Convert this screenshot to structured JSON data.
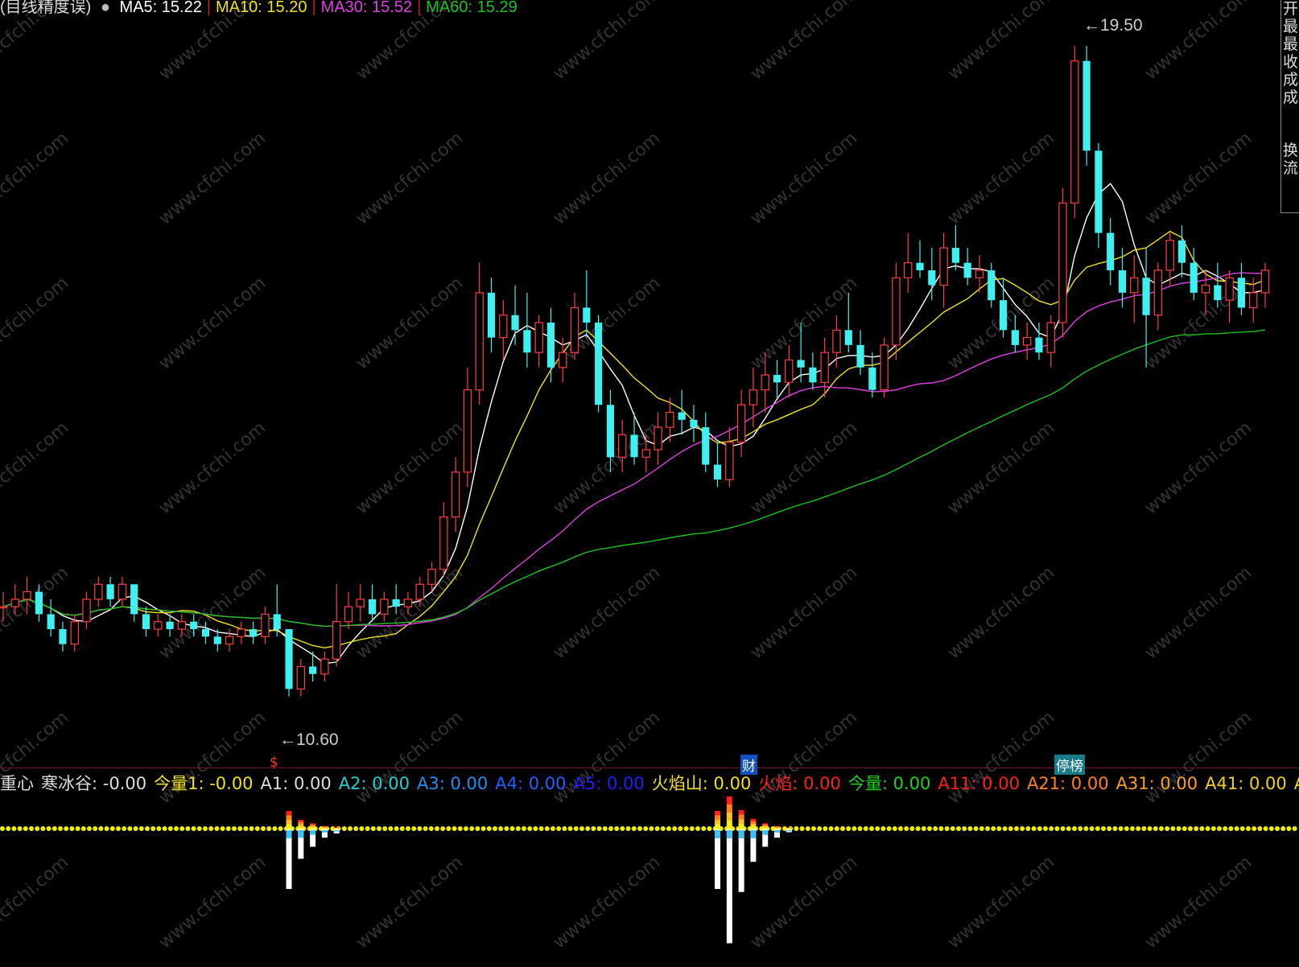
{
  "header": {
    "title_fragment": "(目线精度误)",
    "ma_items": [
      {
        "label": "MA5: 15.22",
        "color": "#ffffff"
      },
      {
        "label": "MA10: 15.20",
        "color": "#f0e020"
      },
      {
        "label": "MA30: 15.52",
        "color": "#e040e0"
      },
      {
        "label": "MA60: 15.29",
        "color": "#20c020"
      }
    ]
  },
  "price_labels": {
    "high": "19.50",
    "low": "10.60"
  },
  "events": [
    {
      "label": "$",
      "color": "#ff3030",
      "bg": "transparent"
    },
    {
      "label": "财",
      "color": "#ffffff",
      "bg": "#1050c0"
    },
    {
      "label": "停榜",
      "color": "#ffffff",
      "bg": "#1a7a8a"
    }
  ],
  "side_panel": [
    "开",
    "最",
    "最",
    "收",
    "成",
    "成",
    "",
    "",
    "换",
    "流"
  ],
  "indicator": {
    "items": [
      {
        "label": "重心",
        "color": "#dddddd"
      },
      {
        "label": "寒冰谷: -0.00",
        "color": "#dddddd"
      },
      {
        "label": "今量1: -0.00",
        "color": "#f0e020"
      },
      {
        "label": "A1: 0.00",
        "color": "#dddddd"
      },
      {
        "label": "A2: 0.00",
        "color": "#20d0d0"
      },
      {
        "label": "A3: 0.00",
        "color": "#2090f0"
      },
      {
        "label": "A4: 0.00",
        "color": "#2060ff"
      },
      {
        "label": "A5: 0.00",
        "color": "#2020ff"
      },
      {
        "label": "火焰山: 0.00",
        "color": "#f0e020"
      },
      {
        "label": "火焰: 0.00",
        "color": "#ff2020"
      },
      {
        "label": "今量: 0.00",
        "color": "#20d020"
      },
      {
        "label": "A11: 0.00",
        "color": "#ff2020"
      },
      {
        "label": "A21: 0.00",
        "color": "#ff8020"
      },
      {
        "label": "A31: 0.00",
        "color": "#ffa020"
      },
      {
        "label": "A41: 0.00",
        "color": "#f0d020"
      },
      {
        "label": "A",
        "color": "#f0d020"
      }
    ]
  },
  "colors": {
    "up": "#ff4040",
    "down": "#40f0f0",
    "ma5": "#ffffff",
    "ma10": "#f0e020",
    "ma30": "#e040e0",
    "ma60": "#20c020",
    "zero_line": "#f0f000",
    "watermark": "#333333"
  },
  "watermark": "www.cfchi.com",
  "chart_data": {
    "type": "candlestick",
    "ylim": [
      10.0,
      19.9
    ],
    "candles": [
      {
        "o": 12.0,
        "h": 12.2,
        "l": 11.8,
        "c": 12.0
      },
      {
        "o": 12.0,
        "h": 12.3,
        "l": 11.9,
        "c": 12.1
      },
      {
        "o": 12.1,
        "h": 12.4,
        "l": 11.9,
        "c": 12.2
      },
      {
        "o": 12.2,
        "h": 12.3,
        "l": 11.8,
        "c": 11.9
      },
      {
        "o": 11.9,
        "h": 12.1,
        "l": 11.6,
        "c": 11.7
      },
      {
        "o": 11.7,
        "h": 11.8,
        "l": 11.4,
        "c": 11.5
      },
      {
        "o": 11.5,
        "h": 11.9,
        "l": 11.4,
        "c": 11.8
      },
      {
        "o": 11.8,
        "h": 12.2,
        "l": 11.7,
        "c": 12.1
      },
      {
        "o": 12.1,
        "h": 12.4,
        "l": 12.0,
        "c": 12.3
      },
      {
        "o": 12.3,
        "h": 12.4,
        "l": 12.0,
        "c": 12.1
      },
      {
        "o": 12.1,
        "h": 12.4,
        "l": 12.0,
        "c": 12.3
      },
      {
        "o": 12.3,
        "h": 12.3,
        "l": 11.8,
        "c": 11.9
      },
      {
        "o": 11.9,
        "h": 12.0,
        "l": 11.6,
        "c": 11.7
      },
      {
        "o": 11.7,
        "h": 11.9,
        "l": 11.6,
        "c": 11.8
      },
      {
        "o": 11.8,
        "h": 11.9,
        "l": 11.6,
        "c": 11.7
      },
      {
        "o": 11.7,
        "h": 11.9,
        "l": 11.6,
        "c": 11.8
      },
      {
        "o": 11.8,
        "h": 11.9,
        "l": 11.6,
        "c": 11.7
      },
      {
        "o": 11.7,
        "h": 11.8,
        "l": 11.5,
        "c": 11.6
      },
      {
        "o": 11.6,
        "h": 11.7,
        "l": 11.4,
        "c": 11.5
      },
      {
        "o": 11.5,
        "h": 11.7,
        "l": 11.4,
        "c": 11.6
      },
      {
        "o": 11.6,
        "h": 11.8,
        "l": 11.5,
        "c": 11.7
      },
      {
        "o": 11.7,
        "h": 11.8,
        "l": 11.5,
        "c": 11.6
      },
      {
        "o": 11.6,
        "h": 12.0,
        "l": 11.5,
        "c": 11.9
      },
      {
        "o": 11.9,
        "h": 12.3,
        "l": 11.6,
        "c": 11.7
      },
      {
        "o": 11.7,
        "h": 11.7,
        "l": 10.8,
        "c": 10.9
      },
      {
        "o": 10.9,
        "h": 11.3,
        "l": 10.8,
        "c": 11.2
      },
      {
        "o": 11.2,
        "h": 11.4,
        "l": 11.0,
        "c": 11.1
      },
      {
        "o": 11.1,
        "h": 11.4,
        "l": 11.0,
        "c": 11.3
      },
      {
        "o": 11.3,
        "h": 12.3,
        "l": 11.2,
        "c": 11.8
      },
      {
        "o": 11.8,
        "h": 12.2,
        "l": 11.7,
        "c": 12.0
      },
      {
        "o": 12.0,
        "h": 12.3,
        "l": 11.8,
        "c": 12.1
      },
      {
        "o": 12.1,
        "h": 12.3,
        "l": 11.8,
        "c": 11.9
      },
      {
        "o": 11.9,
        "h": 12.2,
        "l": 11.8,
        "c": 12.1
      },
      {
        "o": 12.1,
        "h": 12.3,
        "l": 11.9,
        "c": 12.0
      },
      {
        "o": 12.0,
        "h": 12.2,
        "l": 11.9,
        "c": 12.1
      },
      {
        "o": 12.1,
        "h": 12.4,
        "l": 12.0,
        "c": 12.3
      },
      {
        "o": 12.3,
        "h": 12.6,
        "l": 12.2,
        "c": 12.5
      },
      {
        "o": 12.5,
        "h": 13.4,
        "l": 12.4,
        "c": 13.2
      },
      {
        "o": 13.2,
        "h": 14.0,
        "l": 13.0,
        "c": 13.8
      },
      {
        "o": 13.8,
        "h": 15.2,
        "l": 13.6,
        "c": 14.9
      },
      {
        "o": 14.9,
        "h": 16.6,
        "l": 14.7,
        "c": 16.2
      },
      {
        "o": 16.2,
        "h": 16.4,
        "l": 15.4,
        "c": 15.6
      },
      {
        "o": 15.6,
        "h": 16.1,
        "l": 15.3,
        "c": 15.9
      },
      {
        "o": 15.9,
        "h": 16.3,
        "l": 15.5,
        "c": 15.7
      },
      {
        "o": 15.7,
        "h": 16.2,
        "l": 15.2,
        "c": 15.4
      },
      {
        "o": 15.4,
        "h": 15.9,
        "l": 15.2,
        "c": 15.8
      },
      {
        "o": 15.8,
        "h": 16.0,
        "l": 15.0,
        "c": 15.2
      },
      {
        "o": 15.2,
        "h": 15.6,
        "l": 15.0,
        "c": 15.4
      },
      {
        "o": 15.4,
        "h": 16.2,
        "l": 15.3,
        "c": 16.0
      },
      {
        "o": 16.0,
        "h": 16.5,
        "l": 15.6,
        "c": 15.8
      },
      {
        "o": 15.8,
        "h": 15.9,
        "l": 14.6,
        "c": 14.7
      },
      {
        "o": 14.7,
        "h": 14.9,
        "l": 13.8,
        "c": 14.0
      },
      {
        "o": 14.0,
        "h": 14.5,
        "l": 13.8,
        "c": 14.3
      },
      {
        "o": 14.3,
        "h": 14.6,
        "l": 13.9,
        "c": 14.0
      },
      {
        "o": 14.0,
        "h": 14.3,
        "l": 13.8,
        "c": 14.1
      },
      {
        "o": 14.1,
        "h": 14.6,
        "l": 13.9,
        "c": 14.4
      },
      {
        "o": 14.4,
        "h": 14.8,
        "l": 14.2,
        "c": 14.6
      },
      {
        "o": 14.6,
        "h": 14.9,
        "l": 14.3,
        "c": 14.5
      },
      {
        "o": 14.5,
        "h": 14.7,
        "l": 14.2,
        "c": 14.4
      },
      {
        "o": 14.4,
        "h": 14.6,
        "l": 13.8,
        "c": 13.9
      },
      {
        "o": 13.9,
        "h": 14.2,
        "l": 13.6,
        "c": 13.7
      },
      {
        "o": 13.7,
        "h": 14.4,
        "l": 13.6,
        "c": 14.2
      },
      {
        "o": 14.2,
        "h": 14.9,
        "l": 14.0,
        "c": 14.7
      },
      {
        "o": 14.7,
        "h": 15.2,
        "l": 14.4,
        "c": 14.9
      },
      {
        "o": 14.9,
        "h": 15.4,
        "l": 14.6,
        "c": 15.1
      },
      {
        "o": 15.1,
        "h": 15.3,
        "l": 14.8,
        "c": 15.0
      },
      {
        "o": 15.0,
        "h": 15.5,
        "l": 14.8,
        "c": 15.3
      },
      {
        "o": 15.3,
        "h": 15.8,
        "l": 15.0,
        "c": 15.2
      },
      {
        "o": 15.2,
        "h": 15.4,
        "l": 14.9,
        "c": 15.0
      },
      {
        "o": 15.0,
        "h": 15.6,
        "l": 14.8,
        "c": 15.4
      },
      {
        "o": 15.4,
        "h": 15.9,
        "l": 15.2,
        "c": 15.7
      },
      {
        "o": 15.7,
        "h": 16.2,
        "l": 15.4,
        "c": 15.5
      },
      {
        "o": 15.5,
        "h": 15.7,
        "l": 15.1,
        "c": 15.2
      },
      {
        "o": 15.2,
        "h": 15.4,
        "l": 14.8,
        "c": 14.9
      },
      {
        "o": 14.9,
        "h": 15.6,
        "l": 14.8,
        "c": 15.5
      },
      {
        "o": 15.5,
        "h": 16.6,
        "l": 15.3,
        "c": 16.4
      },
      {
        "o": 16.4,
        "h": 17.0,
        "l": 16.2,
        "c": 16.6
      },
      {
        "o": 16.6,
        "h": 16.9,
        "l": 16.4,
        "c": 16.5
      },
      {
        "o": 16.5,
        "h": 16.8,
        "l": 16.1,
        "c": 16.3
      },
      {
        "o": 16.3,
        "h": 17.0,
        "l": 16.0,
        "c": 16.8
      },
      {
        "o": 16.8,
        "h": 17.1,
        "l": 16.5,
        "c": 16.6
      },
      {
        "o": 16.6,
        "h": 16.8,
        "l": 16.3,
        "c": 16.4
      },
      {
        "o": 16.4,
        "h": 16.7,
        "l": 16.2,
        "c": 16.5
      },
      {
        "o": 16.5,
        "h": 16.6,
        "l": 16.0,
        "c": 16.1
      },
      {
        "o": 16.1,
        "h": 16.4,
        "l": 15.6,
        "c": 15.7
      },
      {
        "o": 15.7,
        "h": 15.9,
        "l": 15.4,
        "c": 15.5
      },
      {
        "o": 15.5,
        "h": 15.8,
        "l": 15.3,
        "c": 15.6
      },
      {
        "o": 15.6,
        "h": 15.8,
        "l": 15.3,
        "c": 15.4
      },
      {
        "o": 15.4,
        "h": 15.9,
        "l": 15.2,
        "c": 15.8
      },
      {
        "o": 15.8,
        "h": 17.6,
        "l": 15.6,
        "c": 17.4
      },
      {
        "o": 17.4,
        "h": 19.5,
        "l": 17.2,
        "c": 19.3
      },
      {
        "o": 19.3,
        "h": 19.5,
        "l": 17.9,
        "c": 18.1
      },
      {
        "o": 18.1,
        "h": 18.2,
        "l": 16.8,
        "c": 17.0
      },
      {
        "o": 17.0,
        "h": 17.2,
        "l": 16.3,
        "c": 16.5
      },
      {
        "o": 16.5,
        "h": 16.8,
        "l": 16.0,
        "c": 16.2
      },
      {
        "o": 16.2,
        "h": 16.7,
        "l": 15.8,
        "c": 16.4
      },
      {
        "o": 16.4,
        "h": 16.8,
        "l": 15.2,
        "c": 15.9
      },
      {
        "o": 15.9,
        "h": 16.6,
        "l": 15.7,
        "c": 16.5
      },
      {
        "o": 16.5,
        "h": 17.0,
        "l": 16.3,
        "c": 16.9
      },
      {
        "o": 16.9,
        "h": 17.1,
        "l": 16.4,
        "c": 16.6
      },
      {
        "o": 16.6,
        "h": 16.8,
        "l": 16.1,
        "c": 16.2
      },
      {
        "o": 16.2,
        "h": 16.5,
        "l": 15.9,
        "c": 16.3
      },
      {
        "o": 16.3,
        "h": 16.6,
        "l": 16.0,
        "c": 16.1
      },
      {
        "o": 16.1,
        "h": 16.5,
        "l": 15.8,
        "c": 16.4
      },
      {
        "o": 16.4,
        "h": 16.6,
        "l": 15.9,
        "c": 16.0
      },
      {
        "o": 16.0,
        "h": 16.4,
        "l": 15.8,
        "c": 16.2
      },
      {
        "o": 16.2,
        "h": 16.6,
        "l": 16.0,
        "c": 16.5
      }
    ],
    "volume_bars": [
      {
        "index": 24,
        "value": 1.0
      },
      {
        "index": 25,
        "value": 0.5
      },
      {
        "index": 26,
        "value": 0.3
      },
      {
        "index": 27,
        "value": 0.15
      },
      {
        "index": 28,
        "value": 0.08
      },
      {
        "index": 60,
        "value": 1.0
      },
      {
        "index": 61,
        "value": 1.9
      },
      {
        "index": 62,
        "value": 1.05
      },
      {
        "index": 63,
        "value": 0.55
      },
      {
        "index": 64,
        "value": 0.3
      },
      {
        "index": 65,
        "value": 0.15
      },
      {
        "index": 66,
        "value": 0.06
      }
    ]
  }
}
